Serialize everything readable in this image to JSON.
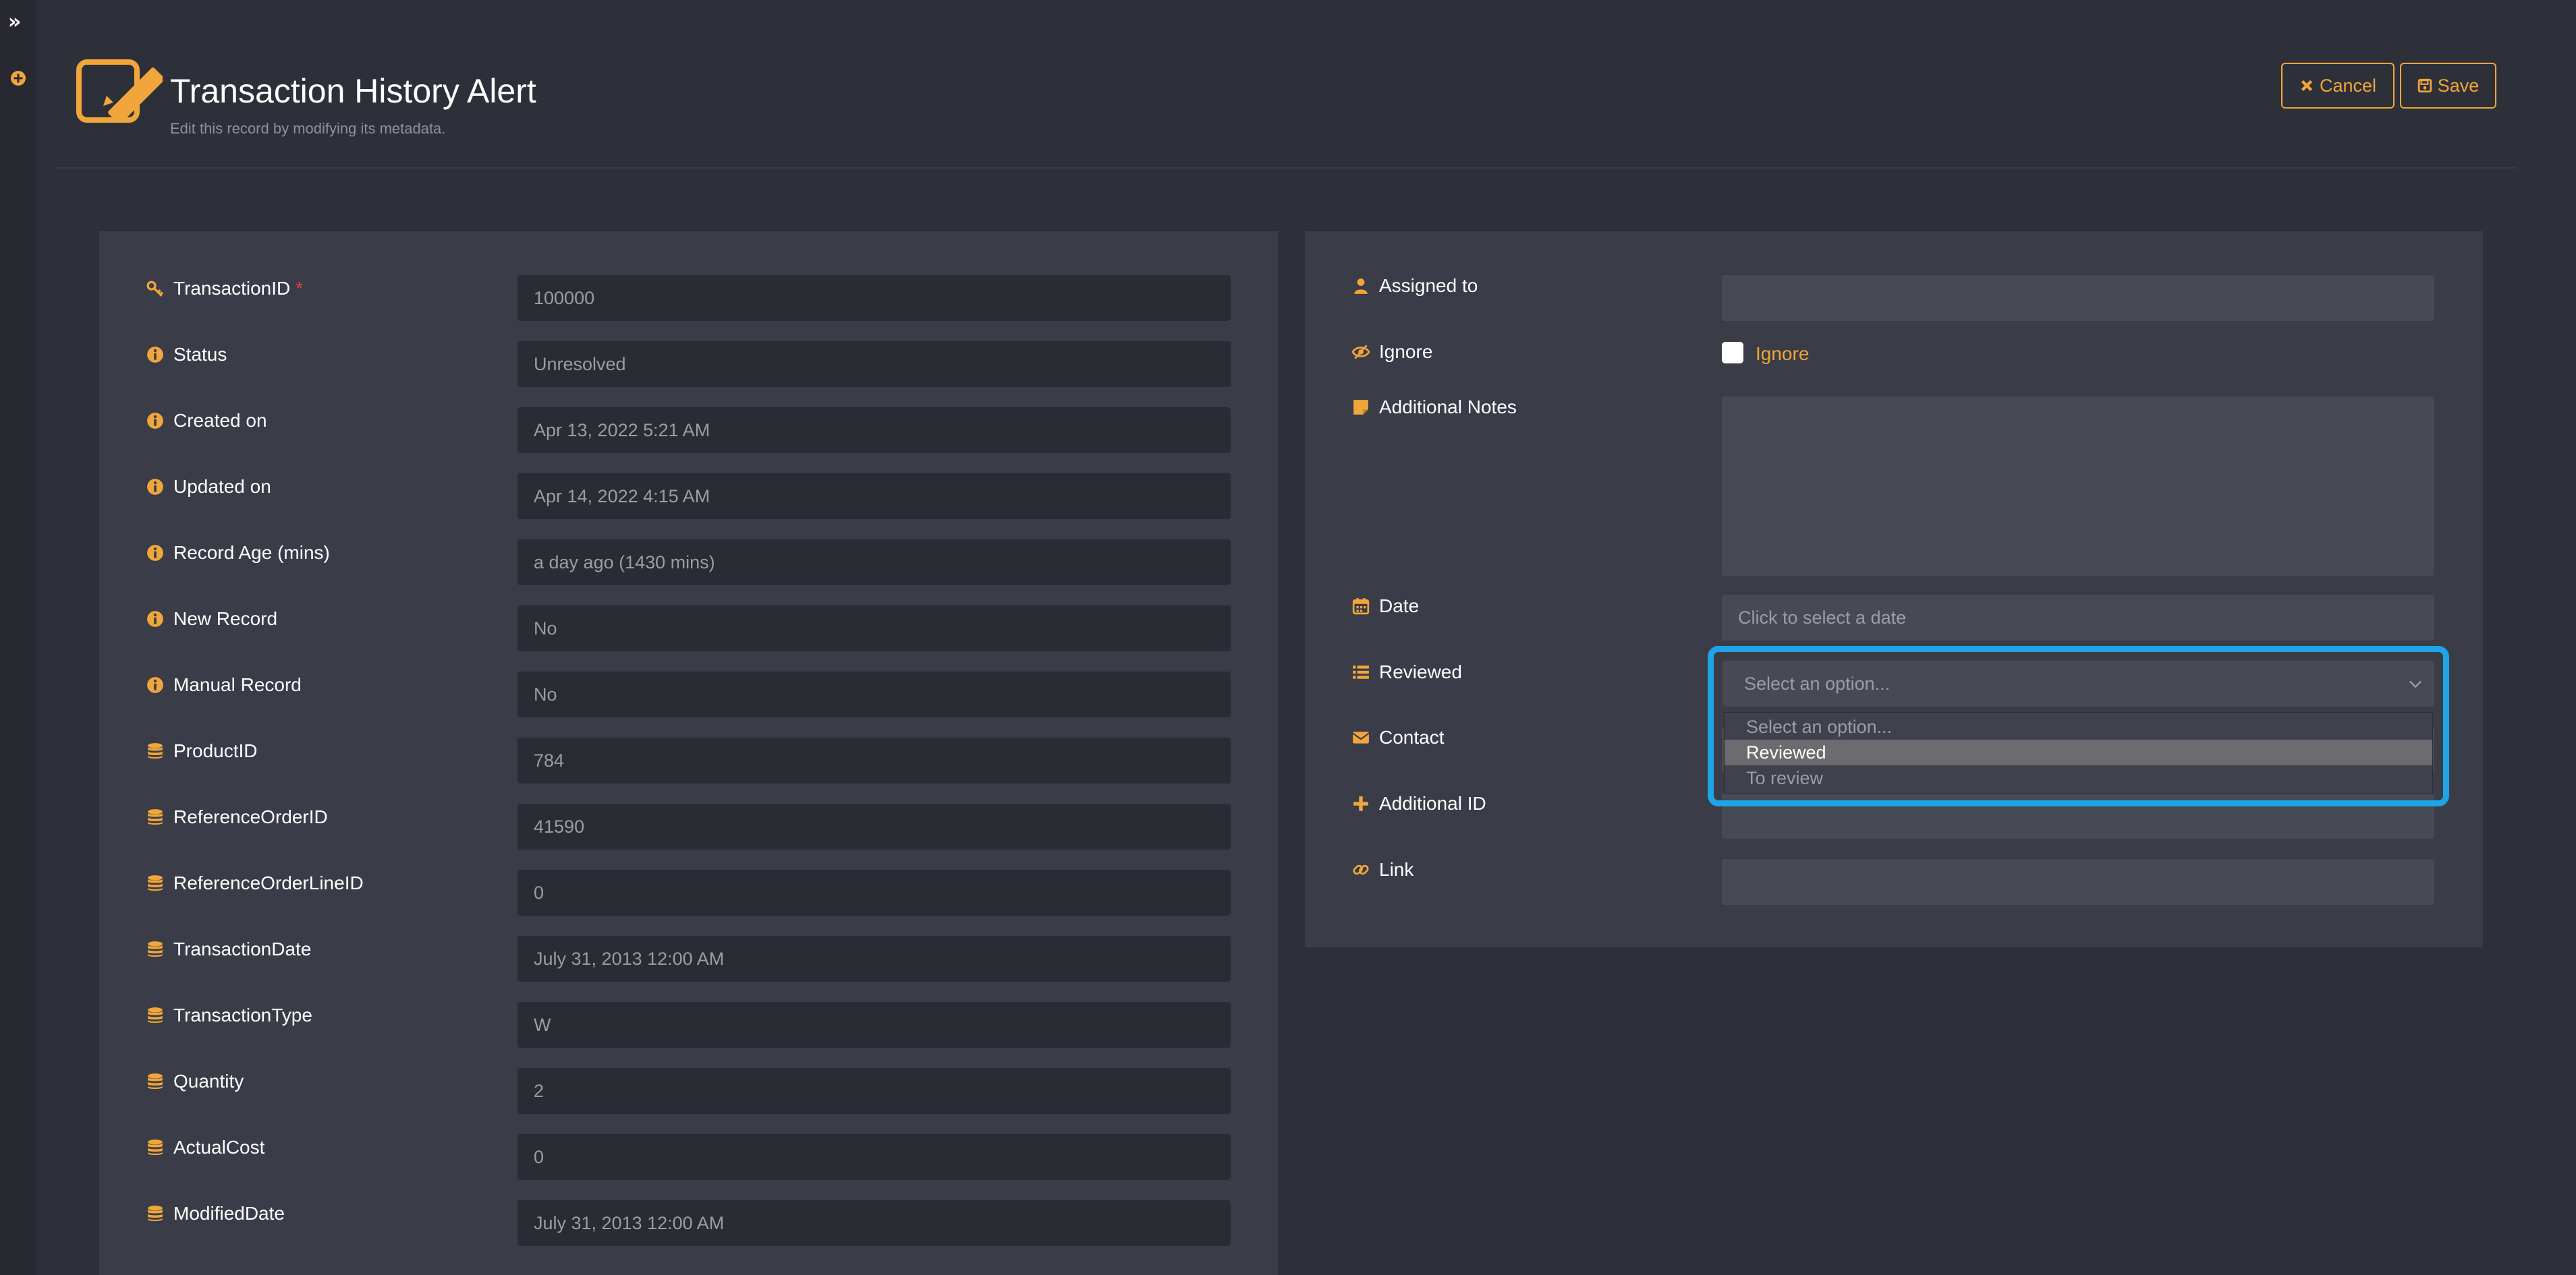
{
  "header": {
    "title": "Transaction History Alert",
    "subtitle": "Edit this record by modifying its metadata.",
    "cancel_label": "Cancel",
    "save_label": "Save"
  },
  "colors": {
    "accent": "#f0a63a",
    "focus_ring": "#1ea5e8",
    "background": "#2e3039",
    "panel": "#3a3c47",
    "required": "#e2403a"
  },
  "left_fields": [
    {
      "label": "TransactionID",
      "value": "100000",
      "icon": "key-icon",
      "required": true
    },
    {
      "label": "Status",
      "value": "Unresolved",
      "icon": "info-icon"
    },
    {
      "label": "Created on",
      "value": "Apr 13, 2022 5:21 AM",
      "icon": "info-icon"
    },
    {
      "label": "Updated on",
      "value": "Apr 14, 2022 4:15 AM",
      "icon": "info-icon"
    },
    {
      "label": "Record Age (mins)",
      "value": "a day ago (1430 mins)",
      "icon": "info-icon"
    },
    {
      "label": "New Record",
      "value": "No",
      "icon": "info-icon"
    },
    {
      "label": "Manual Record",
      "value": "No",
      "icon": "info-icon"
    },
    {
      "label": "ProductID",
      "value": "784",
      "icon": "database-icon"
    },
    {
      "label": "ReferenceOrderID",
      "value": "41590",
      "icon": "database-icon"
    },
    {
      "label": "ReferenceOrderLineID",
      "value": "0",
      "icon": "database-icon"
    },
    {
      "label": "TransactionDate",
      "value": "July 31, 2013 12:00 AM",
      "icon": "database-icon"
    },
    {
      "label": "TransactionType",
      "value": "W",
      "icon": "database-icon"
    },
    {
      "label": "Quantity",
      "value": "2",
      "icon": "database-icon"
    },
    {
      "label": "ActualCost",
      "value": "0",
      "icon": "database-icon"
    },
    {
      "label": "ModifiedDate",
      "value": "July 31, 2013 12:00 AM",
      "icon": "database-icon"
    }
  ],
  "right_fields": {
    "assigned_to": {
      "label": "Assigned to",
      "value": "",
      "icon": "user-icon"
    },
    "ignore": {
      "label": "Ignore",
      "checkbox_label": "Ignore",
      "checked": false,
      "icon": "eye-slash-icon"
    },
    "notes": {
      "label": "Additional Notes",
      "value": "",
      "icon": "sticky-note-icon"
    },
    "date": {
      "label": "Date",
      "placeholder": "Click to select a date",
      "icon": "calendar-icon"
    },
    "reviewed": {
      "label": "Reviewed",
      "placeholder": "Select an option...",
      "icon": "list-icon",
      "options": [
        "Select an option...",
        "Reviewed",
        "To review"
      ],
      "highlighted_option": "Reviewed"
    },
    "contact": {
      "label": "Contact",
      "value": "",
      "icon": "envelope-icon"
    },
    "additional_id": {
      "label": "Additional ID",
      "value": "",
      "icon": "plus-icon"
    },
    "link": {
      "label": "Link",
      "value": "",
      "icon": "link-icon"
    }
  }
}
